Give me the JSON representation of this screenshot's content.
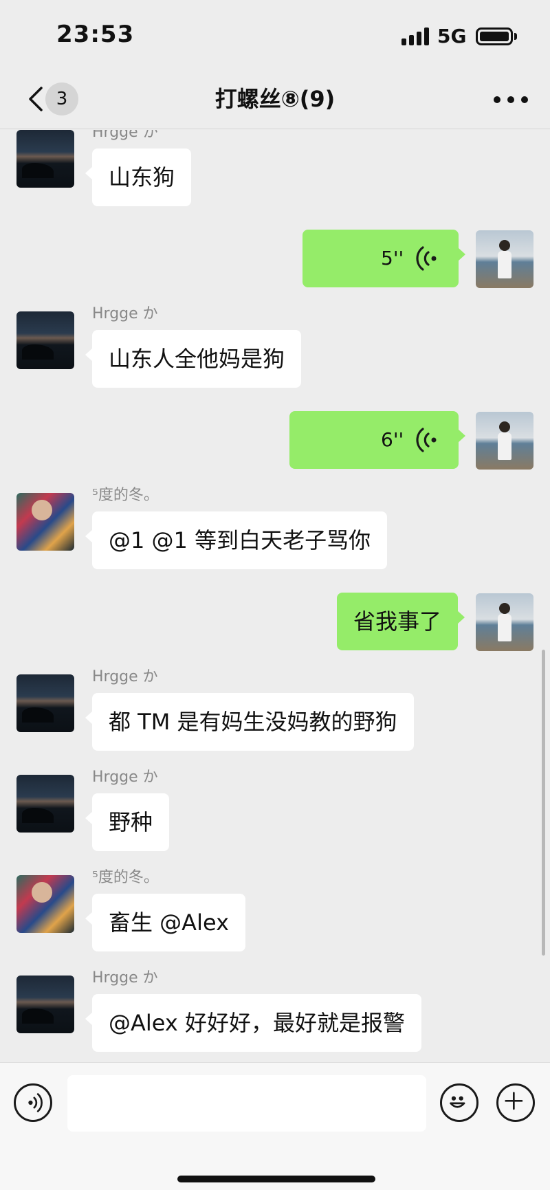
{
  "status_bar": {
    "time": "23:53",
    "network": "5G"
  },
  "nav": {
    "unread_count": "3",
    "title": "打螺丝⑧(9)"
  },
  "messages": [
    {
      "side": "left",
      "type": "text",
      "sender": "Hrgge か",
      "text": "山东狗",
      "avatar": "night-landscape"
    },
    {
      "side": "right",
      "type": "voice",
      "duration": "5''",
      "avatar": "self"
    },
    {
      "side": "left",
      "type": "text",
      "sender": "Hrgge か",
      "text": "山东人全他妈是狗",
      "avatar": "night-landscape"
    },
    {
      "side": "right",
      "type": "voice",
      "duration": "6''",
      "avatar": "self"
    },
    {
      "side": "left",
      "type": "text",
      "sender": "⁵度的冬。",
      "text": "@1 @1 等到白天老子骂你",
      "avatar": "colorful-portrait"
    },
    {
      "side": "right",
      "type": "text",
      "text": "省我事了",
      "avatar": "self"
    },
    {
      "side": "left",
      "type": "text",
      "sender": "Hrgge か",
      "text": "都 TM 是有妈生没妈教的野狗",
      "avatar": "night-landscape"
    },
    {
      "side": "left",
      "type": "text",
      "sender": "Hrgge か",
      "text": "野种",
      "avatar": "night-landscape"
    },
    {
      "side": "left",
      "type": "text",
      "sender": "⁵度的冬。",
      "text": "畜生 @Alex",
      "avatar": "colorful-portrait"
    },
    {
      "side": "left",
      "type": "text",
      "sender": "Hrgge か",
      "text": "@Alex 好好好，最好就是报警",
      "avatar": "night-landscape"
    }
  ],
  "input_bar": {
    "message_value": ""
  },
  "icons": {
    "back": "chevron-left-icon",
    "more": "more-dots-icon",
    "voice_mode": "voice-mode-icon",
    "emoji": "emoji-icon",
    "plus": "plus-icon",
    "voice_wave": "voice-wave-icon"
  },
  "colors": {
    "background": "#ededed",
    "self_bubble": "#95ec69",
    "other_bubble": "#ffffff"
  }
}
